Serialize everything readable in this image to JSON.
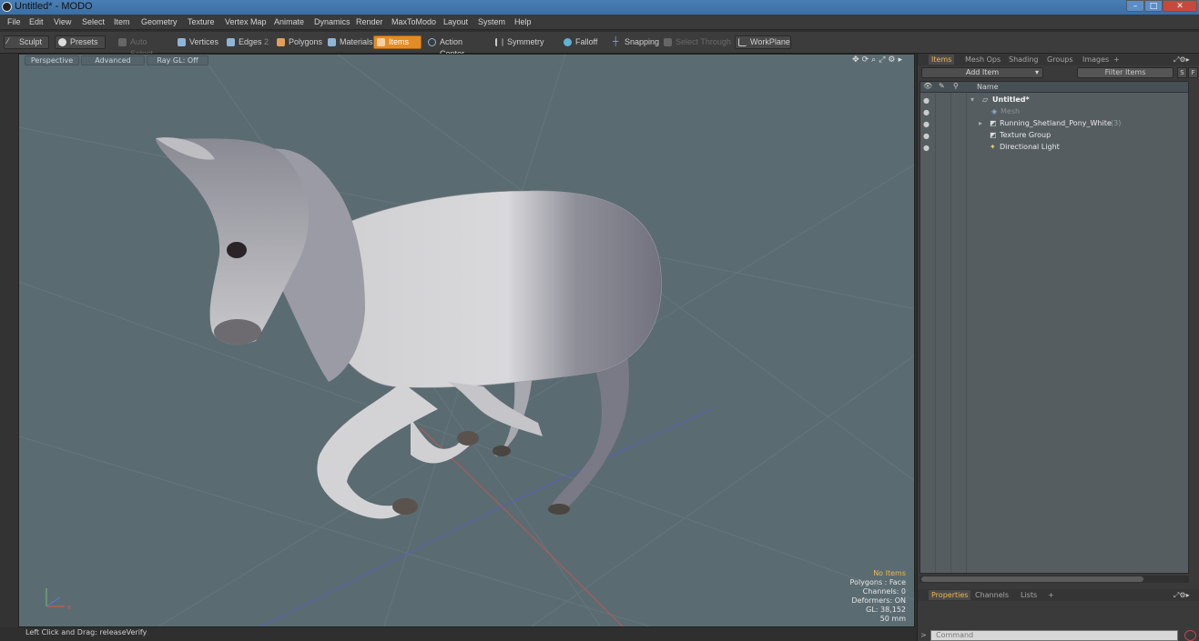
{
  "window": {
    "title": "Untitled* - MODO"
  },
  "menubar": [
    "File",
    "Edit",
    "View",
    "Select",
    "Item",
    "Geometry",
    "Texture",
    "Vertex Map",
    "Animate",
    "Dynamics",
    "Render",
    "MaxToModo",
    "Layout",
    "System",
    "Help"
  ],
  "toolbar": {
    "sculpt": "Sculpt",
    "presets": "Presets",
    "auto_select": "Auto Select",
    "vertices": "Vertices",
    "edges": "Edges",
    "edges_num": "2",
    "polygons": "Polygons",
    "materials": "Materials",
    "items": "Items",
    "action_center": "Action Center",
    "symmetry": "Symmetry",
    "falloff": "Falloff",
    "snapping": "Snapping",
    "select_through": "Select Through",
    "workplane": "WorkPlane"
  },
  "viewport": {
    "tabs": [
      "Perspective",
      "Advanced",
      "Ray GL: Off"
    ],
    "stats": {
      "selection": "No Items",
      "polygons": "Polygons : Face",
      "channels": "Channels: 0",
      "deformers": "Deformers: ON",
      "gl": "GL: 38,152",
      "scale": "50 mm"
    }
  },
  "statusbar": {
    "hint": "Left Click and Drag:  releaseVerify"
  },
  "items_panel": {
    "tabs": [
      "Items",
      "Mesh Ops",
      "Shading",
      "Groups",
      "Images",
      "+"
    ],
    "add_item": "Add Item",
    "filter": "Filter Items",
    "btn_s": "S",
    "btn_f": "F",
    "column_name": "Name",
    "rows": [
      {
        "label": "Untitled*",
        "count": ""
      },
      {
        "label": "Mesh",
        "count": ""
      },
      {
        "label": "Running_Shetland_Pony_White",
        "count": "(3)"
      },
      {
        "label": "Texture Group",
        "count": ""
      },
      {
        "label": "Directional Light",
        "count": ""
      }
    ]
  },
  "properties_panel": {
    "tabs": [
      "Properties",
      "Channels",
      "Lists",
      "+"
    ]
  },
  "command": {
    "placeholder": "Command"
  },
  "colors": {
    "accent": "#e38c26",
    "viewport_bg": "#5b6b72",
    "highlight_text": "#f0b64a"
  }
}
